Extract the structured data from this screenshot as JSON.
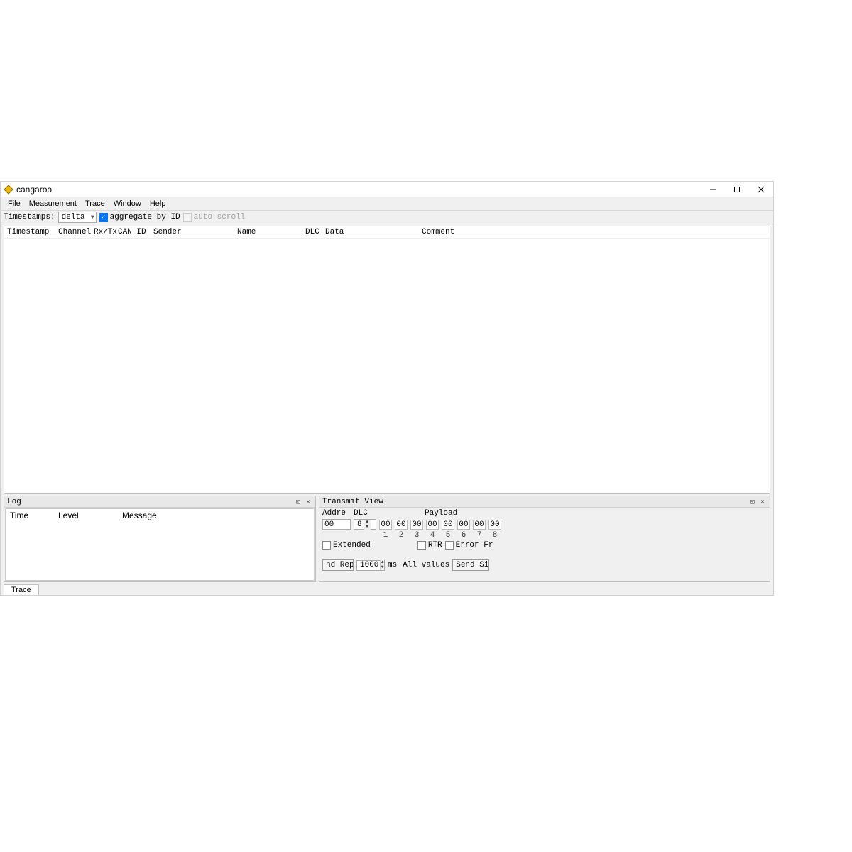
{
  "window": {
    "title": "cangaroo"
  },
  "menu": {
    "items": [
      "File",
      "Measurement",
      "Trace",
      "Window",
      "Help"
    ]
  },
  "toolbar": {
    "timestamps_label": "Timestamps:",
    "timestamps_value": "delta",
    "aggregate_label": "aggregate by ID",
    "aggregate_checked": true,
    "autoscroll_label": "auto scroll",
    "autoscroll_checked": false
  },
  "trace": {
    "columns": [
      "Timestamp",
      "Channel",
      "Rx/Tx",
      "CAN ID",
      "Sender",
      "Name",
      "DLC",
      "Data",
      "Comment"
    ]
  },
  "log": {
    "title": "Log",
    "columns": [
      "Time",
      "Level",
      "Message"
    ]
  },
  "transmit": {
    "title": "Transmit View",
    "address_label": "Addre",
    "address_value": "00",
    "dlc_label": "DLC",
    "dlc_value": "8",
    "payload_label": "Payload",
    "payload": [
      "00",
      "00",
      "00",
      "00",
      "00",
      "00",
      "00",
      "00"
    ],
    "payload_idx": [
      "1",
      "2",
      "3",
      "4",
      "5",
      "6",
      "7",
      "8"
    ],
    "extended_label": "Extended",
    "rtr_label": "RTR",
    "errorframe_label": "Error Fr",
    "repeat_button": "nd Repea",
    "repeat_value": "1000",
    "repeat_unit": "ms",
    "allvalues_label": "All values",
    "sendsingle_button": "Send Single"
  },
  "tabs": {
    "trace": "Trace"
  }
}
